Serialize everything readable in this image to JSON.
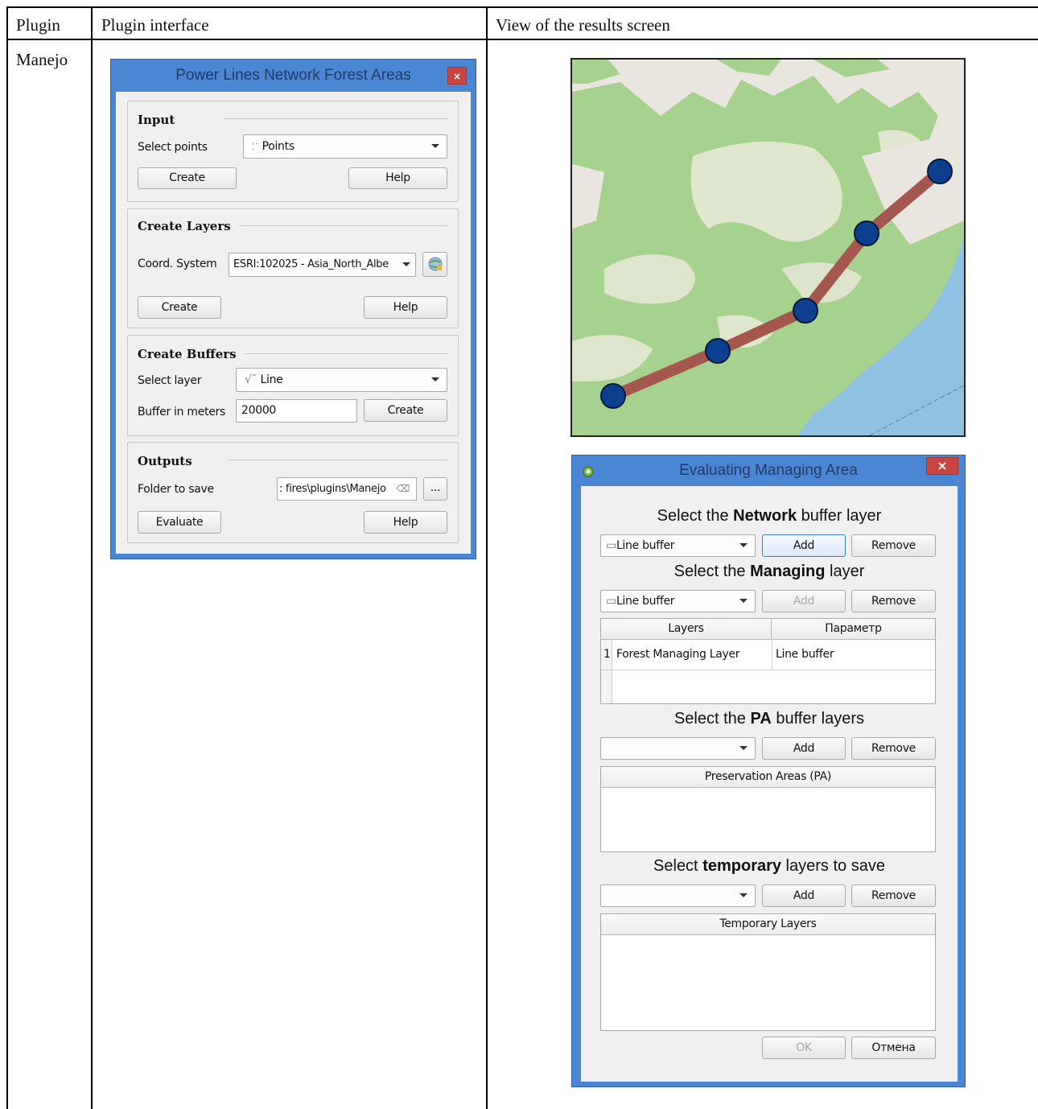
{
  "table": {
    "headers": [
      "Plugin",
      "Plugin interface",
      "View of the results screen"
    ],
    "row_label": "Manejo"
  },
  "dialog1": {
    "title": "Power Lines Network Forest Areas",
    "close_glyph": "×",
    "input": {
      "title": "Input",
      "select_points_label": "Select points",
      "points_value": "Points",
      "create_label": "Create",
      "help_label": "Help"
    },
    "create_layers": {
      "title": "Create Layers",
      "coord_label": "Coord. System",
      "coord_value": "ESRI:102025 - Asia_North_Albe",
      "create_label": "Create",
      "help_label": "Help"
    },
    "create_buffers": {
      "title": "Create Buffers",
      "select_layer_label": "Select layer",
      "layer_value": "Line",
      "buffer_label": "Buffer in meters",
      "buffer_value": "20000",
      "create_label": "Create"
    },
    "outputs": {
      "title": "Outputs",
      "folder_label": "Folder to save",
      "folder_value": ": fires\\plugins\\Manejo",
      "browse_label": "...",
      "evaluate_label": "Evaluate",
      "help_label": "Help"
    }
  },
  "map": {
    "colors": {
      "land": "#e9e6df",
      "forest": "#a7d18e",
      "water": "#8fc1e3",
      "line": "#a4574f",
      "node": "#0d3f8f"
    }
  },
  "dialog2": {
    "title": "Evaluating Managing Area",
    "close_glyph": "×",
    "network": {
      "heading_pre": "Select the ",
      "heading_bold": "Network",
      "heading_post": " buffer layer",
      "combo_value": "Line buffer",
      "add_label": "Add",
      "remove_label": "Remove"
    },
    "managing": {
      "heading_pre": "Select the ",
      "heading_bold": "Managing",
      "heading_post": " layer",
      "combo_value": "Line buffer",
      "add_label": "Add",
      "remove_label": "Remove"
    },
    "layers_table": {
      "headers": [
        "Layers",
        "Параметр"
      ],
      "rows": [
        {
          "index": "1",
          "layer": "Forest Managing Layer",
          "param": "Line buffer"
        }
      ]
    },
    "pa": {
      "heading_pre": "Select the ",
      "heading_bold": "PA",
      "heading_post": " buffer layers",
      "combo_value": "",
      "add_label": "Add",
      "remove_label": "Remove",
      "list_header": "Preservation Areas (PA)"
    },
    "temporary": {
      "heading_pre": "Select ",
      "heading_bold": "temporary",
      "heading_post": " layers to save",
      "combo_value": "",
      "add_label": "Add",
      "remove_label": "Remove",
      "list_header": "Temporary Layers"
    },
    "ok_label": "OK",
    "cancel_label": "Отмена"
  }
}
